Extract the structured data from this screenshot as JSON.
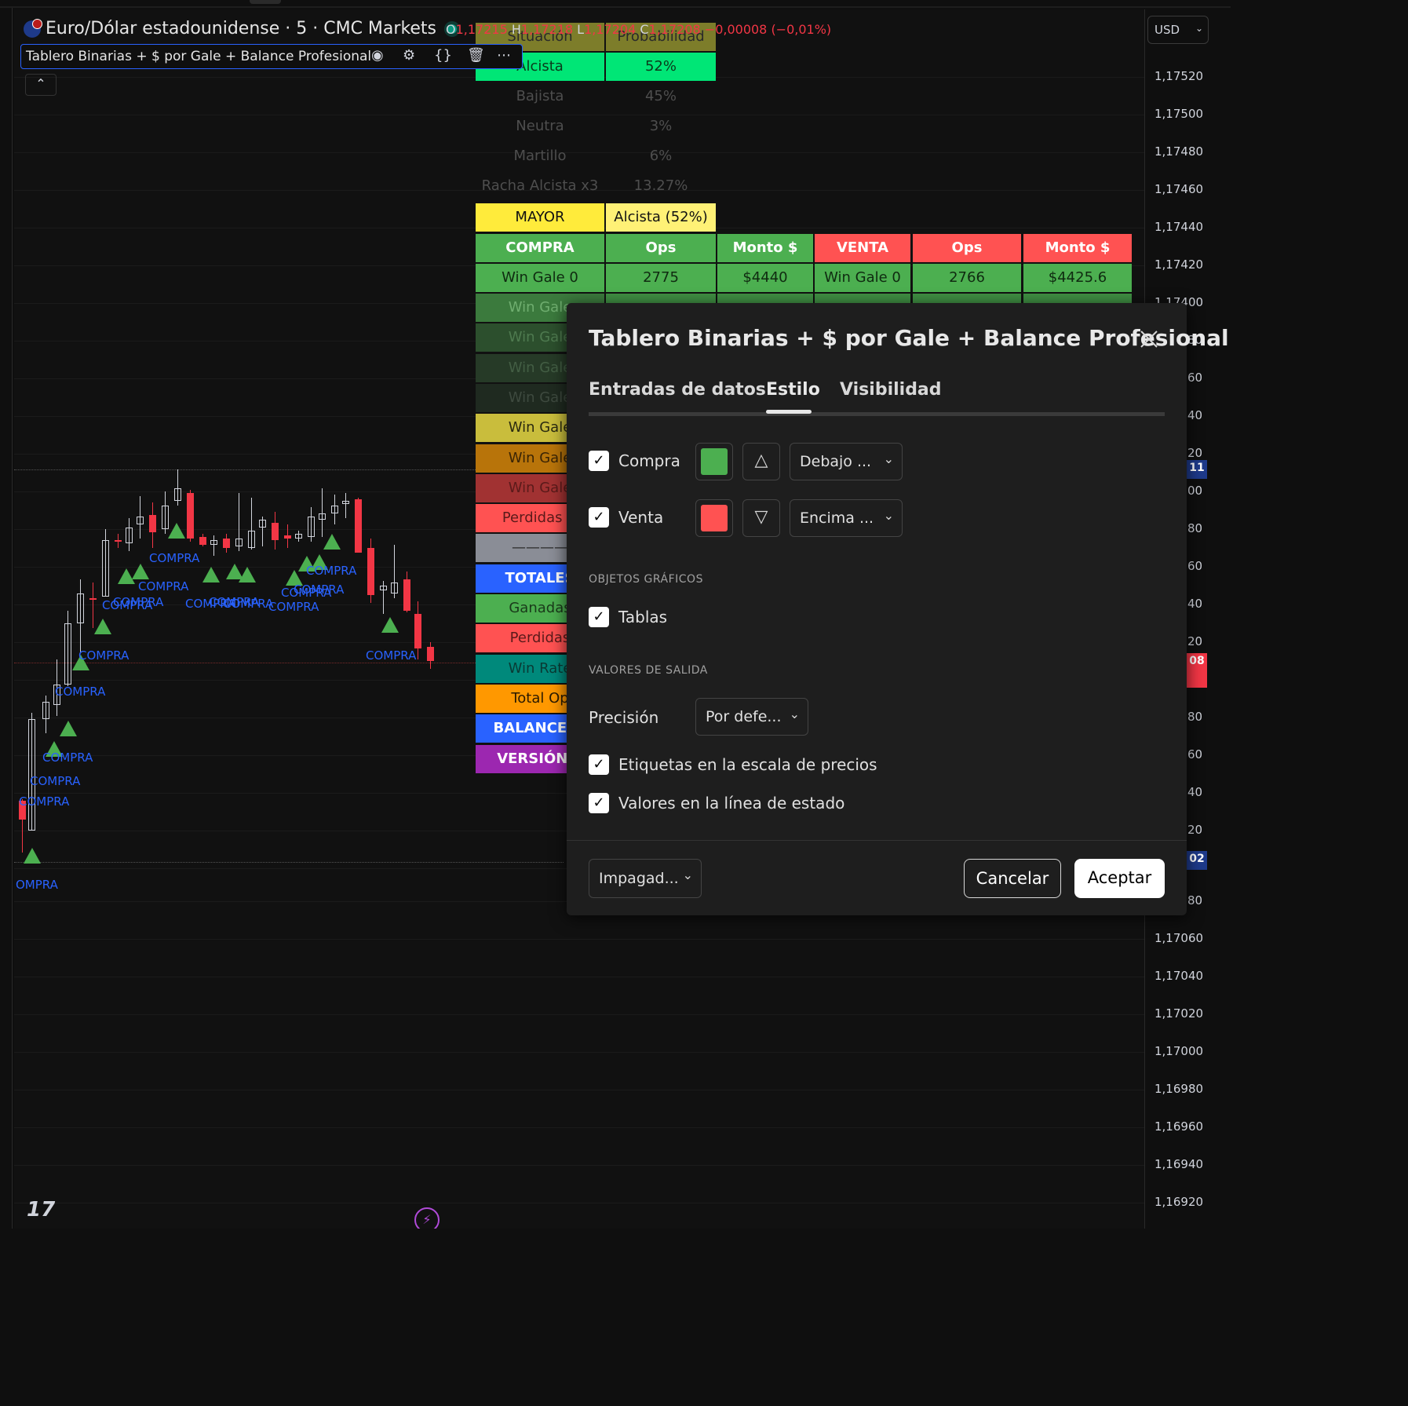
{
  "header": {
    "symbol_title": "Euro/Dólar estadounidense · 5 · CMC Markets",
    "ohlc_o_label": "O",
    "ohlc_o": "1,17215",
    "ohlc_h_label": "H",
    "ohlc_h": "1,17218",
    "ohlc_l_label": "L",
    "ohlc_l": "1,17204",
    "ohlc_c_label": "C",
    "ohlc_c": "1,17208",
    "ohlc_change": "−0,00008 (−0,01%)",
    "currency": "USD"
  },
  "indicator": {
    "name": "Tablero Binarias + $ por Gale + Balance Profesional"
  },
  "price_scale": [
    "1,17520",
    "1,17500",
    "1,17480",
    "1,17460",
    "1,17440",
    "1,17420",
    "1,17400",
    "80",
    "60",
    "40",
    "20",
    "00",
    "80",
    "60",
    "40",
    "20",
    "80",
    "60",
    "40",
    "20",
    "80",
    "1,17060",
    "1,17040",
    "1,17020",
    "1,17000",
    "1,16980",
    "1,16960",
    "1,16940",
    "1,16920"
  ],
  "price_badges": {
    "blue_top": "11",
    "red": "08",
    "blue_bottom": "02"
  },
  "prob_table": {
    "headers": [
      "Situación",
      "Probabilidad"
    ],
    "rows": [
      [
        "Alcista",
        "52%"
      ],
      [
        "Bajista",
        "45%"
      ],
      [
        "Neutra",
        "3%"
      ],
      [
        "Martillo",
        "6%"
      ],
      [
        "Racha Alcista x3",
        "13.27%"
      ]
    ],
    "mayor_label": "MAYOR",
    "mayor_value": "Alcista (52%)"
  },
  "gale_table": {
    "headers": [
      "COMPRA",
      "Ops",
      "Monto $",
      "VENTA",
      "Ops",
      "Monto $"
    ],
    "row0": [
      "Win Gale 0",
      "2775",
      "$4440",
      "Win Gale 0",
      "2766",
      "$4425.6"
    ],
    "left_rows": [
      "Win Gale",
      "Win Gale",
      "Win Gale",
      "Win Gale",
      "Win Gale",
      "Win Gale",
      "Win Gale",
      "Perdidas G",
      "————",
      "TOTALES",
      "Ganadas",
      "Perdidas",
      "Win Rate",
      "Total Op",
      "BALANCE FI",
      "VERSIÓN P"
    ]
  },
  "chart_labels": {
    "buy": "COMPRA",
    "buy_cut": "OMPRA"
  },
  "dialog": {
    "title": "Tablero Binarias + $ por Gale + Balance Profesional",
    "tabs": [
      "Entradas de datos",
      "Estilo",
      "Visibilidad"
    ],
    "active_tab": "Estilo",
    "compra_label": "Compra",
    "compra_color": "#4caf50",
    "compra_shape": "triangle-up-icon",
    "compra_position": "Debajo ...",
    "venta_label": "Venta",
    "venta_color": "#ff5252",
    "venta_shape": "triangle-down-icon",
    "venta_position": "Encima ...",
    "section_graphics": "OBJETOS GRÁFICOS",
    "tablas_label": "Tablas",
    "section_output": "VALORES DE SALIDA",
    "precision_label": "Precisión",
    "precision_value": "Por defe...",
    "price_scale_labels": "Etiquetas en la escala de precios",
    "status_line_values": "Valores en la línea de estado",
    "template_select": "Impagad...",
    "cancel_label": "Cancelar",
    "accept_label": "Aceptar"
  }
}
